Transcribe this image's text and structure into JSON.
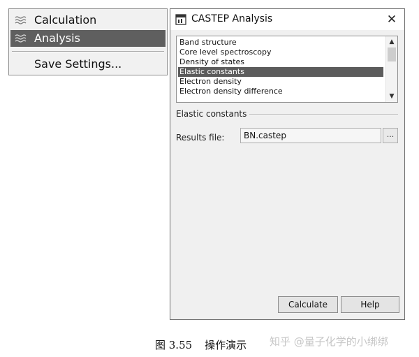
{
  "menu": {
    "items": [
      {
        "label": "Calculation",
        "icon": "wave-icon",
        "selected": false
      },
      {
        "label": "Analysis",
        "icon": "wave-icon",
        "selected": true
      }
    ],
    "save_label": "Save Settings..."
  },
  "dialog": {
    "title": "CASTEP Analysis",
    "close_glyph": "✕",
    "list": {
      "items": [
        "Band structure",
        "Core level spectroscopy",
        "Density of states",
        "Elastic constants",
        "Electron density",
        "Electron density difference"
      ],
      "selected": "Elastic constants"
    },
    "group_label": "Elastic constants",
    "results_label": "Results file:",
    "results_value": "BN.castep",
    "browse_label": "...",
    "calculate_label": "Calculate",
    "help_label": "Help"
  },
  "caption": {
    "number": "图 3.55",
    "text": "操作演示"
  },
  "watermark": "知乎 @量子化学的小绑绑",
  "colors": {
    "selection": "#5c5c5c",
    "dialog_bg": "#f0f0f0",
    "menu_bg": "#f1f1f1"
  }
}
